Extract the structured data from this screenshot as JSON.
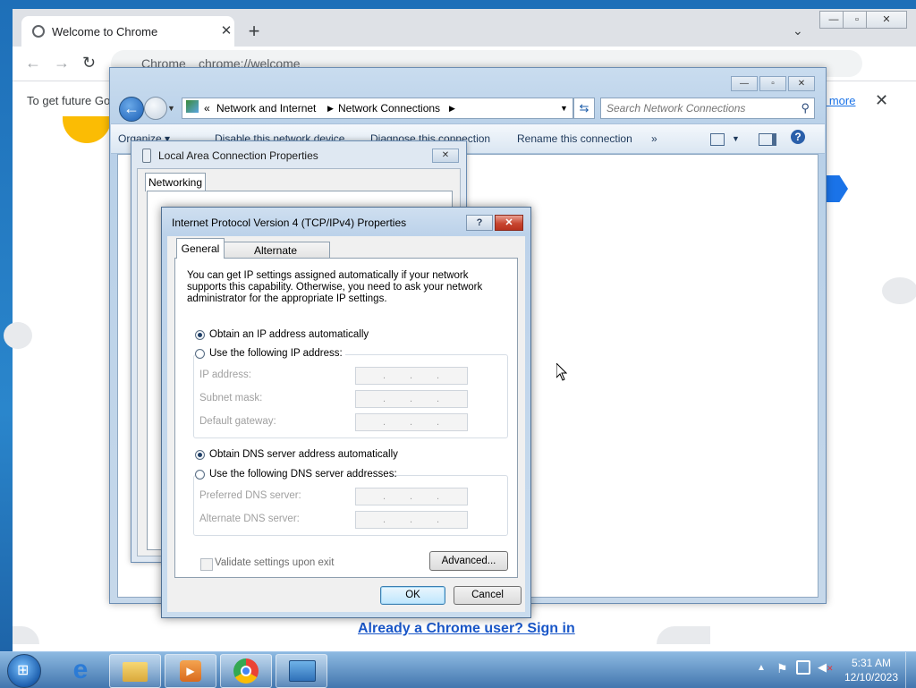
{
  "chrome": {
    "tab_title": "Welcome to Chrome",
    "tab_close": "✕",
    "new_tab": "+",
    "omnibox_site": "Chrome",
    "omnibox_url": "chrome://welcome",
    "infobar_text": "To get future Go",
    "infobar_link": "n more",
    "infobar_close": "✕",
    "signin_link": "Already a Chrome user? Sign in"
  },
  "network_window": {
    "breadcrumb_prefix": "«",
    "breadcrumbs": [
      "Network and Internet",
      "Network Connections"
    ],
    "search_placeholder": "Search Network Connections",
    "commands": {
      "organize": "Organize ▾",
      "disable": "Disable this network device",
      "diagnose": "Diagnose this connection",
      "rename": "Rename this connection",
      "more": "»"
    }
  },
  "lac_dialog": {
    "title": "Local Area Connection Properties",
    "tab": "Networking",
    "close": "✕"
  },
  "ipv4_dialog": {
    "title": "Internet Protocol Version 4 (TCP/IPv4) Properties",
    "help": "?",
    "close": "✕",
    "tabs": {
      "general": "General",
      "alternate": "Alternate Configuration"
    },
    "intro": "You can get IP settings assigned automatically if your network supports this capability. Otherwise, you need to ask your network administrator for the appropriate IP settings.",
    "ip_auto": "Obtain an IP address automatically",
    "ip_manual": "Use the following IP address:",
    "ip_address_label": "IP address:",
    "subnet_label": "Subnet mask:",
    "gateway_label": "Default gateway:",
    "dns_auto": "Obtain DNS server address automatically",
    "dns_manual": "Use the following DNS server addresses:",
    "preferred_dns_label": "Preferred DNS server:",
    "alternate_dns_label": "Alternate DNS server:",
    "validate": "Validate settings upon exit",
    "advanced": "Advanced...",
    "ok": "OK",
    "cancel": "Cancel",
    "ip_auto_selected": true,
    "dns_auto_selected": true,
    "validate_checked": false
  },
  "taskbar": {
    "time": "5:31 AM",
    "date": "12/10/2023",
    "icons": [
      "internet-explorer-icon",
      "file-explorer-icon",
      "media-player-icon",
      "chrome-icon",
      "control-panel-icon"
    ]
  },
  "colors": {
    "accent": "#1a73e8",
    "dialog_frame": "#bcd2ea",
    "close_red": "#c84630"
  }
}
